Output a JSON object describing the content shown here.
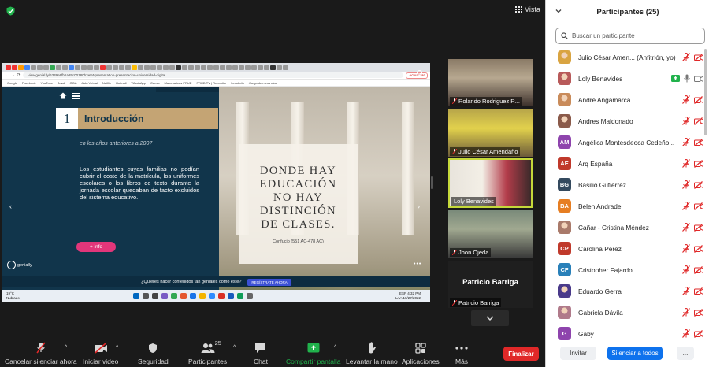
{
  "stage": {
    "view_label": "Vista"
  },
  "browser": {
    "url": "view.genial.ly/6339e9fb1a85c00180b3e84/presentation-presentacion-universidad-digital",
    "update_label": "Actualizar",
    "bookmarks": [
      "Google",
      "Facebook",
      "YouTube",
      "Jmail",
      "OGA",
      "Aula Virtual",
      "Netflix",
      "Hotmail",
      "WhatsApp",
      "Canva",
      "Matematicas PRUE",
      "PRUD TV | Repositor",
      "Lexobeth",
      "Juego de mesa alas"
    ]
  },
  "slide": {
    "number": "1",
    "title": "Introducción",
    "subtitle": "en los años anteriores a 2007",
    "body": "Los estudiantes cuyas familias no podían cubrir el costo de la matrícula, los uniformes escolares o los libros de texto durante la jornada escolar quedaban de facto excluidos del sistema educativo.",
    "info_button": "+ info",
    "quote": "DONDE HAY\nEDUCACIÓN\nNO HAY\nDISTINCIÓN\nDE CLASES.",
    "quote_author": "Confucio (551 AC-478 AC)",
    "logo_text": "genially",
    "banner_text": "¿Quieres hacer contenidos tan geniales como este?",
    "banner_cta": "REGÍSTRATE AHORA"
  },
  "taskbar": {
    "weather_temp": "19°C",
    "weather_text": "Nublado",
    "lang": "ESP",
    "lang2": "LAA",
    "time": "4:32 PM",
    "date": "10/27/2022"
  },
  "tiles": [
    {
      "name": "Rolando Rodriguez R..."
    },
    {
      "name": "Julio César Amendaño"
    },
    {
      "name": "Loly Benavides"
    },
    {
      "name": "Jhon Ojeda"
    },
    {
      "name": "Patricio Barriga",
      "big": "Patricio Barriga"
    }
  ],
  "toolbar": {
    "mute": "Cancelar silenciar ahora",
    "video": "Iniciar video",
    "security": "Seguridad",
    "participants": "Participantes",
    "participants_count": "25",
    "chat": "Chat",
    "share": "Compartir pantalla",
    "raise_hand": "Levantar la mano",
    "apps": "Aplicaciones",
    "more": "Más",
    "end": "Finalizar"
  },
  "panel": {
    "title": "Participantes (25)",
    "search_placeholder": "Buscar un participante",
    "invite": "Invitar",
    "mute_all": "Silenciar a todos",
    "more": "...",
    "participants": [
      {
        "name": "Julio César Amen... (Anfitrión, yo)",
        "initials": "",
        "color": "#d9a441"
      },
      {
        "name": "Loly Benavides",
        "initials": "",
        "color": "#b85a5a"
      },
      {
        "name": "Andre Angamarca",
        "initials": "",
        "color": "#c98b5a"
      },
      {
        "name": "Andres Maldonado",
        "initials": "",
        "color": "#8a5a4a"
      },
      {
        "name": "Angélica Montesdeoca Cedeño...",
        "initials": "AM",
        "color": "#8e44ad"
      },
      {
        "name": "Arq España",
        "initials": "AE",
        "color": "#c0392b"
      },
      {
        "name": "Basilio Gutierrez",
        "initials": "BG",
        "color": "#34495e"
      },
      {
        "name": "Belen Andrade",
        "initials": "BA",
        "color": "#e67e22"
      },
      {
        "name": "Cañar - Cristina Méndez",
        "initials": "",
        "color": "#a97a6a"
      },
      {
        "name": "Carolina Perez",
        "initials": "CP",
        "color": "#c0392b"
      },
      {
        "name": "Cristopher Fajardo",
        "initials": "CF",
        "color": "#2980b9"
      },
      {
        "name": "Eduardo Gerra",
        "initials": "",
        "color": "#4a3a8a"
      },
      {
        "name": "Gabriela Dávila",
        "initials": "",
        "color": "#b07a8a"
      },
      {
        "name": "Gaby",
        "initials": "G",
        "color": "#8e44ad"
      }
    ]
  },
  "colors": {
    "slide_blue": "#11354b",
    "slide_gold": "#c4a474",
    "info_pink": "#e2367a",
    "end_red": "#e02828",
    "share_green": "#21b24c",
    "primary_blue": "#0e72ed",
    "muted_red": "#e02828",
    "active_speaker": "#c5d93a"
  }
}
